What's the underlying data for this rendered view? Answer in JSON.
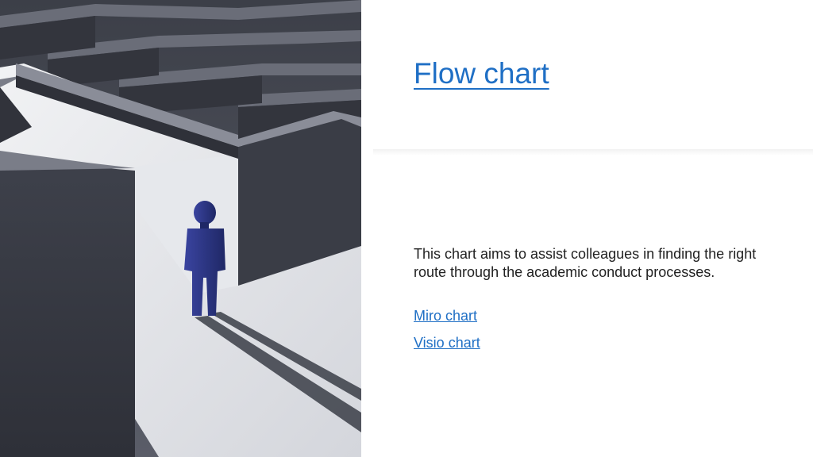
{
  "slide": {
    "title": "Flow chart",
    "body": "This chart aims to assist colleagues in finding the right route through the academic conduct processes.",
    "links": [
      {
        "label": "Miro chart"
      },
      {
        "label": "Visio chart"
      }
    ]
  },
  "image": {
    "icon": "maze-person-image"
  },
  "colors": {
    "title": "#1f6fc5",
    "link": "#1f6fc5",
    "body_text": "#222222",
    "maze_wall": "#4a4d58",
    "path_floor": "#e4e6ea",
    "figure": "#2c3580"
  }
}
